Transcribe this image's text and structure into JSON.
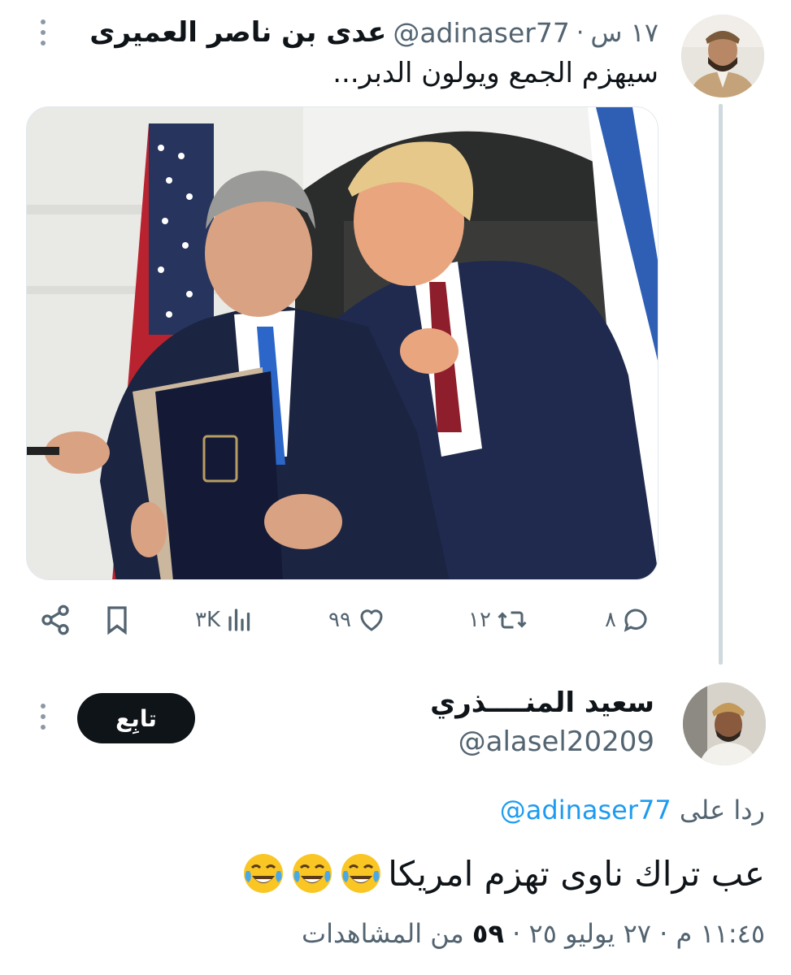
{
  "tweet": {
    "author_name": "عدى بن ناصر العميرى",
    "author_handle": "@adinaser77",
    "separator": "·",
    "time_ago": "١٧ س",
    "text": "سيهزم الجمع ويولون الدبر...",
    "stats": {
      "replies": "٨",
      "retweets": "١٢",
      "likes": "٩٩",
      "views": "٣K"
    }
  },
  "reply": {
    "author_name": "سعيد المنــــذري",
    "author_handle": "@alasel20209",
    "follow_label": "تابِع",
    "replying_prefix": "ردا على",
    "replying_to": "@adinaser77",
    "text": "عب تراك ناوى تهزم امريكا",
    "emoji": [
      "face-with-tears-of-joy",
      "face-with-tears-of-joy",
      "face-with-tears-of-joy"
    ],
    "time": "١١:٤٥ م",
    "date": "٢٧ يوليو ٢٥",
    "separator": "·",
    "views_count": "٥٩",
    "views_label": "من المشاهدات"
  },
  "colors": {
    "text": "#0f1419",
    "secondary": "#536471",
    "link": "#1d9bf0",
    "follow_bg": "#0f1419",
    "thread_line": "#cfd9de"
  }
}
